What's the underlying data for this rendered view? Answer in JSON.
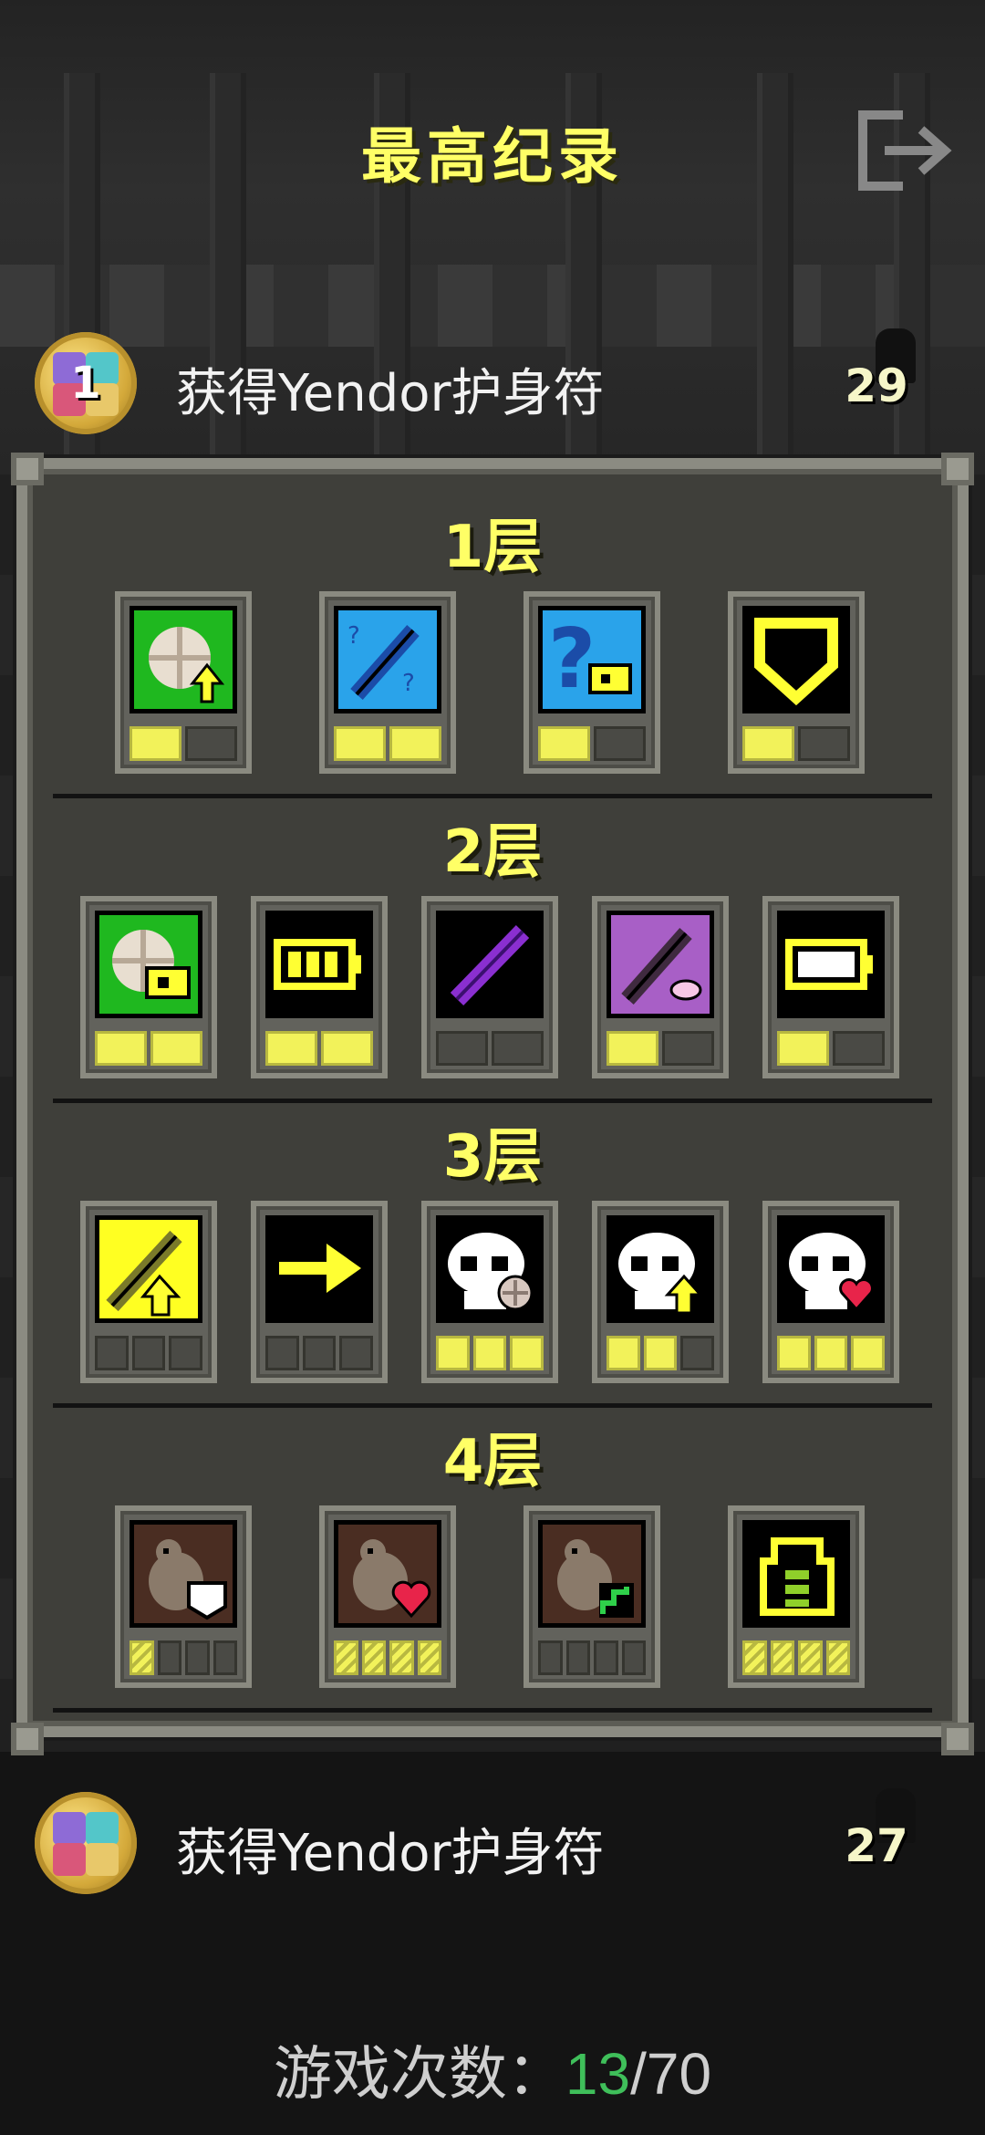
{
  "screen": {
    "title": "最高纪录"
  },
  "records": [
    {
      "rank": "1",
      "text": "获得Yendor护身符",
      "depth": "29"
    },
    {
      "rank": "",
      "text": "获得Yendor护身符",
      "depth": "27"
    }
  ],
  "panel": {
    "tiers": [
      {
        "label": "1层",
        "badges": [
          {
            "icon": "map-upgrade-icon",
            "pips": [
              1,
              0
            ]
          },
          {
            "icon": "wand-identify-icon",
            "pips": [
              1,
              1
            ]
          },
          {
            "icon": "identify-badge-icon",
            "pips": [
              1,
              0
            ]
          },
          {
            "icon": "armor-shield-icon",
            "pips": [
              1,
              0
            ]
          }
        ]
      },
      {
        "label": "2层",
        "badges": [
          {
            "icon": "map-badge-icon",
            "pips": [
              1,
              1
            ]
          },
          {
            "icon": "battery-full-icon",
            "pips": [
              1,
              1
            ]
          },
          {
            "icon": "purple-wand-icon",
            "pips": [
              0,
              0
            ]
          },
          {
            "icon": "wand-catalog-icon",
            "pips": [
              1,
              0
            ]
          },
          {
            "icon": "battery-empty-icon",
            "pips": [
              1,
              0
            ]
          }
        ]
      },
      {
        "label": "3层",
        "badges": [
          {
            "icon": "golden-wand-upgrade-icon",
            "pips": [
              0,
              0,
              0
            ]
          },
          {
            "icon": "arrow-right-icon",
            "pips": [
              0,
              0,
              0
            ]
          },
          {
            "icon": "skull-plus-icon",
            "pips": [
              1,
              1,
              1
            ]
          },
          {
            "icon": "skull-upgrade-icon",
            "pips": [
              1,
              1,
              0
            ]
          },
          {
            "icon": "skull-heart-icon",
            "pips": [
              1,
              1,
              1
            ]
          }
        ]
      },
      {
        "label": "4层",
        "badges": [
          {
            "icon": "rat-armor-icon",
            "pips": [
              1,
              0,
              0,
              0
            ]
          },
          {
            "icon": "rat-heart-icon",
            "pips": [
              1,
              1,
              1,
              1
            ]
          },
          {
            "icon": "rat-stairs-icon",
            "pips": [
              0,
              0,
              0,
              0
            ]
          },
          {
            "icon": "backpack-icon",
            "pips": [
              1,
              1,
              1,
              1
            ]
          }
        ]
      }
    ]
  },
  "games": {
    "label": "游戏次数：",
    "current": "13",
    "separator": "/",
    "total": "70"
  },
  "colors": {
    "accent": "#ffff66",
    "current_count": "#3fbf5a",
    "pip_on": "#f2f25a"
  }
}
